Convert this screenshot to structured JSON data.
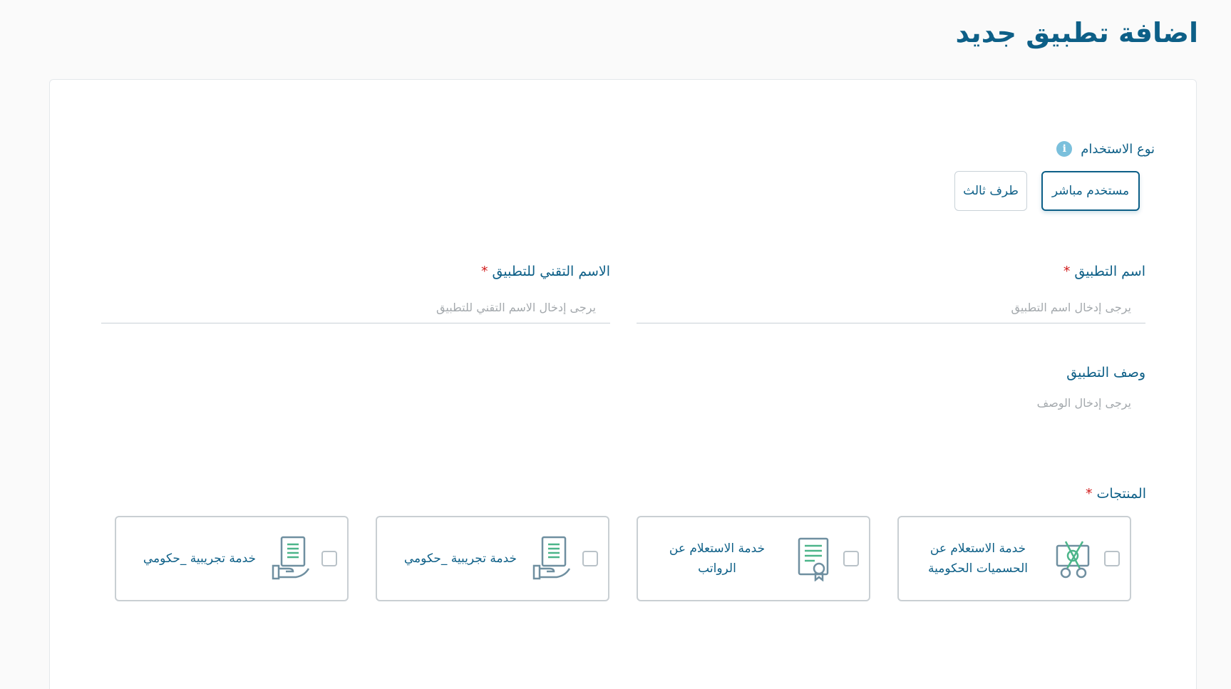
{
  "page": {
    "title": "اضافة تطبيق جديد"
  },
  "usage": {
    "label": "نوع الاستخدام",
    "options": [
      {
        "label": "مستخدم مباشر",
        "selected": true
      },
      {
        "label": "طرف ثالث",
        "selected": false
      }
    ]
  },
  "form": {
    "app_name": {
      "label": "اسم التطبيق",
      "placeholder": "يرجى إدخال اسم التطبيق",
      "required_mark": "*"
    },
    "technical_name": {
      "label": "الاسم التقني للتطبيق",
      "placeholder": "يرجى إدخال الاسم التقني للتطبيق",
      "required_mark": "*"
    },
    "description": {
      "label": "وصف التطبيق",
      "placeholder": "يرجى إدخال الوصف"
    }
  },
  "products": {
    "label": "المنتجات",
    "required_mark": "*",
    "items": [
      {
        "name": "خدمة الاستعلام عن الحسميات الحكومية",
        "icon": "scissors-money-icon"
      },
      {
        "name": "خدمة الاستعلام عن الرواتب",
        "icon": "certificate-icon"
      },
      {
        "name": "خدمة تجريبية _حكومي",
        "icon": "hand-document-icon"
      },
      {
        "name": "خدمة تجريبية _حكومي",
        "icon": "hand-document-icon"
      }
    ]
  },
  "colors": {
    "primary": "#0d5f87",
    "accent_green": "#4cb58a",
    "info": "#7bc0dc",
    "required": "#d11b1b"
  }
}
